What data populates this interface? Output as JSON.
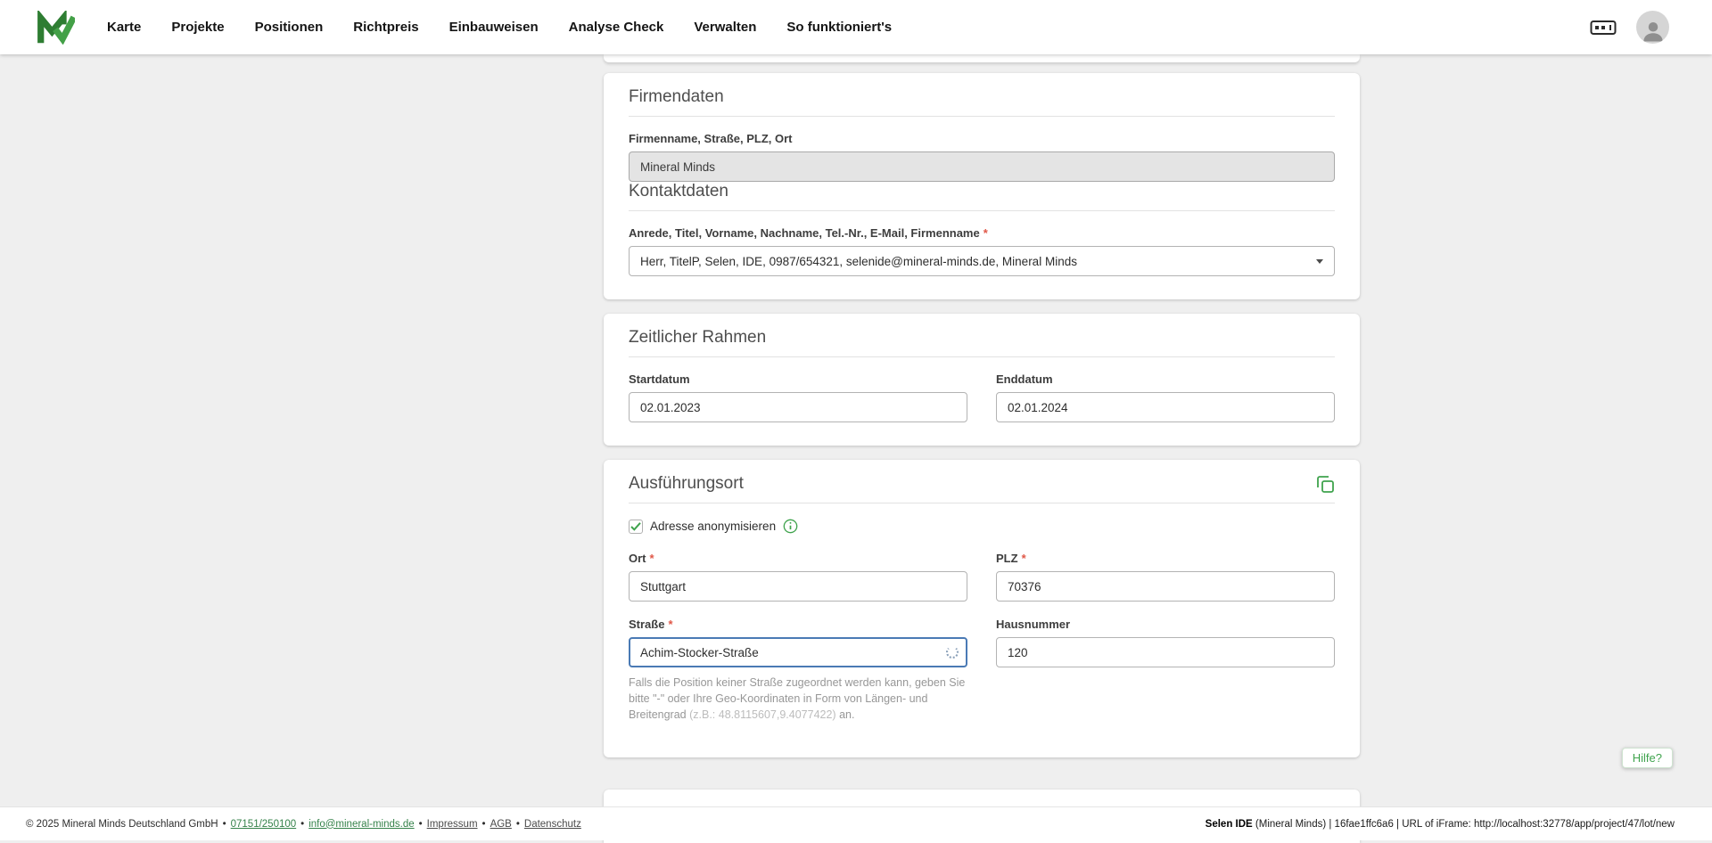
{
  "misc": {
    "required_mark": "*",
    "dot": "•"
  },
  "colors": {
    "brand_green": "#3fa34d",
    "dark_green": "#2e7d32",
    "required_red": "#e05747",
    "focus_border": "#4a7ab5",
    "background_gray": "#efefef"
  },
  "navbar": {
    "items": [
      "Karte",
      "Projekte",
      "Positionen",
      "Richtpreis",
      "Einbauweisen",
      "Analyse Check",
      "Verwalten",
      "So funktioniert's"
    ]
  },
  "firmendaten": {
    "title": "Firmendaten",
    "company_label": "Firmenname, Straße, PLZ, Ort",
    "company_value": "Mineral Minds",
    "kontakt_title": "Kontaktdaten",
    "kontakt_label": "Anrede, Titel, Vorname, Nachname, Tel.-Nr., E-Mail, Firmenname",
    "kontakt_value": "Herr, TitelP, Selen, IDE, 0987/654321, selenide@mineral-minds.de, Mineral Minds"
  },
  "zeitraum": {
    "title": "Zeitlicher Rahmen",
    "start_label": "Startdatum",
    "start_value": "02.01.2023",
    "end_label": "Enddatum",
    "end_value": "02.01.2024"
  },
  "ausfuehrungsort": {
    "title": "Ausführungsort",
    "anonymize_label": "Adresse anonymisieren",
    "ort_label": "Ort",
    "ort_value": "Stuttgart",
    "plz_label": "PLZ",
    "plz_value": "70376",
    "strasse_label": "Straße",
    "strasse_value": "Achim-Stocker-Straße",
    "hausnummer_label": "Hausnummer",
    "hausnummer_value": "120",
    "hint_text": "Falls die Position keiner Straße zugeordnet werden kann, geben Sie bitte \"-\" oder Ihre Geo-Koordinaten in Form von Längen- und Breitengrad ",
    "hint_example": "(z.B.: 48.8115607,9.4077422)",
    "hint_suffix": " an."
  },
  "help_button_label": "Hilfe?",
  "footer": {
    "copyright": "© 2025 Mineral Minds Deutschland GmbH",
    "phone_link": "07151/250100",
    "email_link": "info@mineral-minds.de",
    "impressum_link": "Impressum",
    "agb_link": "AGB",
    "datenschutz_link": "Datenschutz",
    "session_bold": "Selen IDE",
    "session_info": " (Mineral Minds) | 16fae1ffc6a6 | URL of iFrame: http://localhost:32778/app/project/47/lot/new"
  }
}
